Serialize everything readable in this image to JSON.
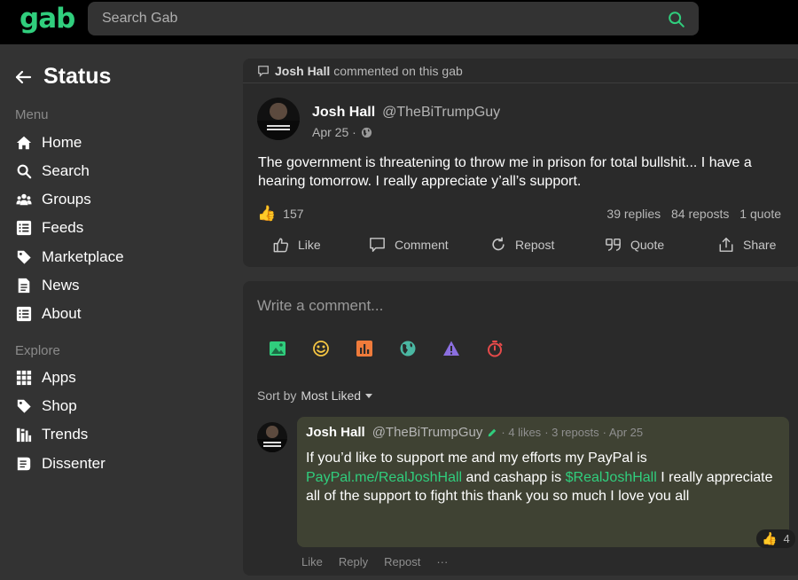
{
  "header": {
    "logo": "gab",
    "search_placeholder": "Search Gab"
  },
  "sidebar": {
    "title": "Status",
    "menu_heading": "Menu",
    "menu_items": [
      {
        "label": "Home",
        "icon": "home-icon"
      },
      {
        "label": "Search",
        "icon": "search-icon"
      },
      {
        "label": "Groups",
        "icon": "groups-icon"
      },
      {
        "label": "Feeds",
        "icon": "feeds-icon"
      },
      {
        "label": "Marketplace",
        "icon": "tag-icon"
      },
      {
        "label": "News",
        "icon": "news-icon"
      },
      {
        "label": "About",
        "icon": "about-icon"
      }
    ],
    "explore_heading": "Explore",
    "explore_items": [
      {
        "label": "Apps",
        "icon": "apps-icon"
      },
      {
        "label": "Shop",
        "icon": "shop-icon"
      },
      {
        "label": "Trends",
        "icon": "trends-icon"
      },
      {
        "label": "Dissenter",
        "icon": "dissenter-icon"
      }
    ]
  },
  "post": {
    "context_name": "Josh Hall",
    "context_text": "commented on this gab",
    "author_name": "Josh Hall",
    "author_handle": "@TheBiTrumpGuy",
    "date": "Apr 25 ·",
    "text": "The government is threatening to throw me in prison for total bullshit... I have a hearing tomorrow. I really appreciate y’all’s support.",
    "like_count": "157",
    "replies": "39 replies",
    "reposts": "84 reposts",
    "quotes": "1 quote",
    "actions": {
      "like": "Like",
      "comment": "Comment",
      "repost": "Repost",
      "quote": "Quote",
      "share": "Share"
    }
  },
  "composer": {
    "placeholder": "Write a comment...",
    "tools": [
      "image-icon",
      "emoji-icon",
      "poll-icon",
      "globe-icon",
      "warning-icon",
      "timer-icon"
    ]
  },
  "sort": {
    "label": "Sort by",
    "value": "Most Liked"
  },
  "reply": {
    "author_name": "Josh Hall",
    "author_handle": "@TheBiTrumpGuy",
    "likes": "· 4 likes",
    "reposts": "· 3 reposts",
    "date": "· Apr 25",
    "text_1": "If you’d like to support me and my efforts my PayPal is ",
    "link_1": "PayPal.me/RealJoshHall",
    "text_2": " and cashapp is ",
    "link_2": "$RealJoshHall",
    "text_3": " I really appreciate all of the support to fight this thank you so much I love you all",
    "reaction_count": "4",
    "actions": {
      "like": "Like",
      "reply": "Reply",
      "repost": "Repost",
      "more": "···"
    }
  },
  "colors": {
    "accent": "#30ce7d",
    "background": "#333333",
    "card": "#2a2a2a",
    "reply_bubble": "#3f4233"
  }
}
